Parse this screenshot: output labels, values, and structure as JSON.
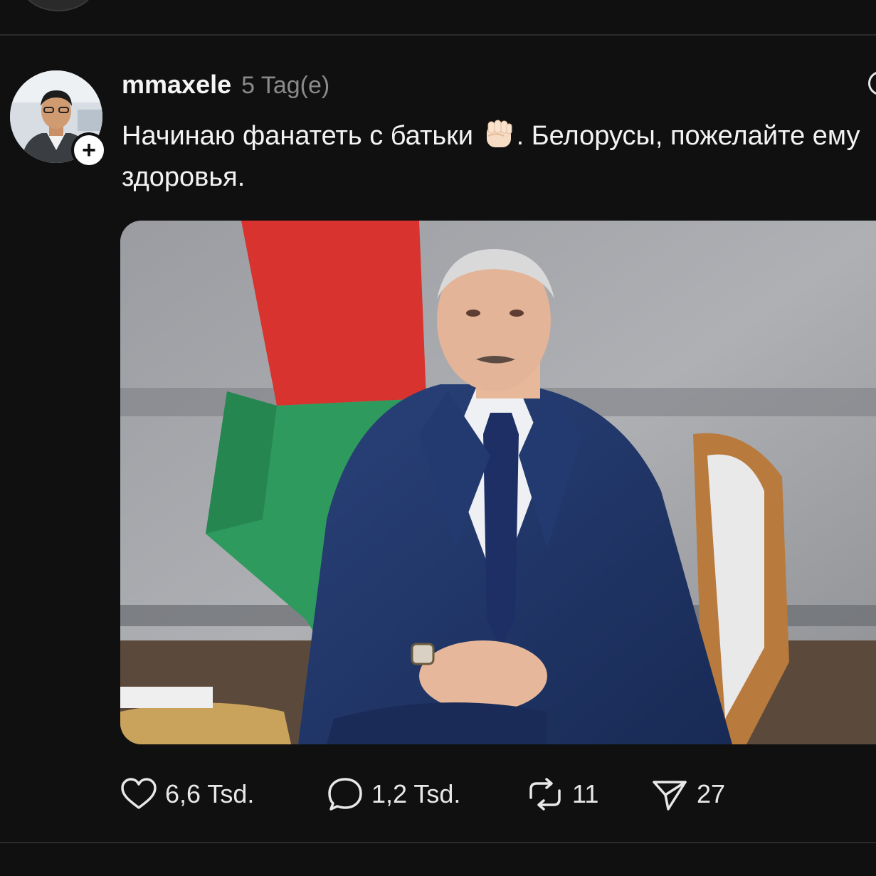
{
  "post": {
    "username": "mmaxele",
    "timestamp": "5 Tag(e)",
    "text_part1": "Начинаю фанатеть с батьки ",
    "text_part2": ". Белорусы, пожелайте ему здоровья.",
    "follow_symbol": "+"
  },
  "actions": {
    "likes": "6,6 Tsd.",
    "replies": "1,2 Tsd.",
    "reposts": "11",
    "shares": "27"
  },
  "icons": {
    "like": "heart-icon",
    "reply": "speech-bubble-icon",
    "repost": "repost-icon",
    "share": "paper-plane-icon",
    "more": "more-options-icon"
  },
  "colors": {
    "background": "#101010",
    "text": "#f3f3f3",
    "muted": "#8a8a8a",
    "divider": "#2b2b2b",
    "flag_red": "#d8332f",
    "flag_green": "#2f9a5d",
    "suit": "#1f3466"
  }
}
